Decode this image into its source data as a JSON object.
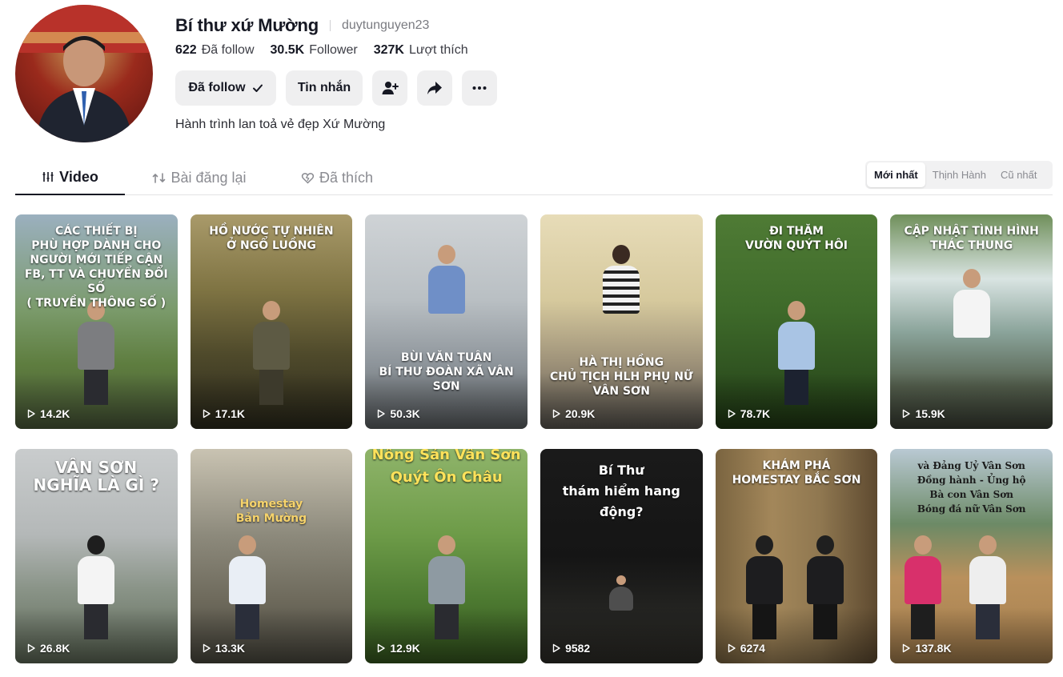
{
  "profile": {
    "display_name": "Bí thư xứ Mường",
    "username": "duytunguyen23",
    "stats": [
      {
        "value": "622",
        "label": "Đã follow"
      },
      {
        "value": "30.5K",
        "label": "Follower"
      },
      {
        "value": "327K",
        "label": "Lượt thích"
      }
    ],
    "bio": "Hành trình lan toả vẻ đẹp Xứ Mường"
  },
  "actions": {
    "follow_label": "Đã follow",
    "message_label": "Tin nhắn",
    "add_friend_icon": "add-friend-icon",
    "share_icon": "share-icon",
    "more_icon": "more-icon"
  },
  "tabs": [
    {
      "label": "Video",
      "icon": "grid-icon",
      "active": true
    },
    {
      "label": "Bài đăng lại",
      "icon": "repost-icon",
      "active": false
    },
    {
      "label": "Đã thích",
      "icon": "heart-icon",
      "active": false
    }
  ],
  "sort": {
    "options": [
      "Mới nhất",
      "Thịnh Hành",
      "Cũ nhất"
    ],
    "selected": "Mới nhất"
  },
  "videos": [
    {
      "title": "CÁC THIẾT BỊ\nPHÙ HỢP DÀNH CHO\nNGƯỜI MỚI TIẾP CẬN\nFB, TT VÀ CHUYỂN ĐỔI SỐ\n( TRUYỀN THÔNG SỐ )",
      "views": "14.2K"
    },
    {
      "title": "HỒ NƯỚC TỰ NHIÊN\nỞ NGỔ LUỒNG",
      "views": "17.1K"
    },
    {
      "title": "BÙI VĂN TUÂN\nBÍ THƯ ĐOÀN XÃ VÂN SƠN",
      "views": "50.3K"
    },
    {
      "title": "HÀ THỊ HỒNG\nCHỦ TỊCH HLH PHỤ NỮ VÂN SƠN",
      "views": "20.9K"
    },
    {
      "title": "ĐI THĂM\nVƯỜN QUÝT HÔI",
      "views": "78.7K"
    },
    {
      "title": "CẬP NHẬT TÌNH HÌNH\nTHÁC THUNG",
      "views": "15.9K"
    },
    {
      "title": "VÂN SƠN\nNGHĨA LÀ GÌ ?",
      "views": "26.8K"
    },
    {
      "title": "Homestay\nBản Mường",
      "views": "13.3K"
    },
    {
      "title": "Nông Sản Vân Sơn\nQuýt Ôn Châu",
      "views": "12.9K"
    },
    {
      "title": "Bí Thư\nthám hiểm hang động?",
      "views": "9582"
    },
    {
      "title": "KHÁM PHÁ\nHOMESTAY BẮC SƠN",
      "views": "6274"
    },
    {
      "title": "và Đảng Uỷ Vân Sơn\nĐồng hành - Ủng hộ\nBà con Vân Sơn\nBóng đá nữ Vân Sơn",
      "views": "137.8K"
    }
  ],
  "colors": {
    "text_primary": "#161823",
    "text_secondary": "#7a7b81",
    "button_bg": "#efeff0",
    "title_highlight": "#ffe25a"
  }
}
